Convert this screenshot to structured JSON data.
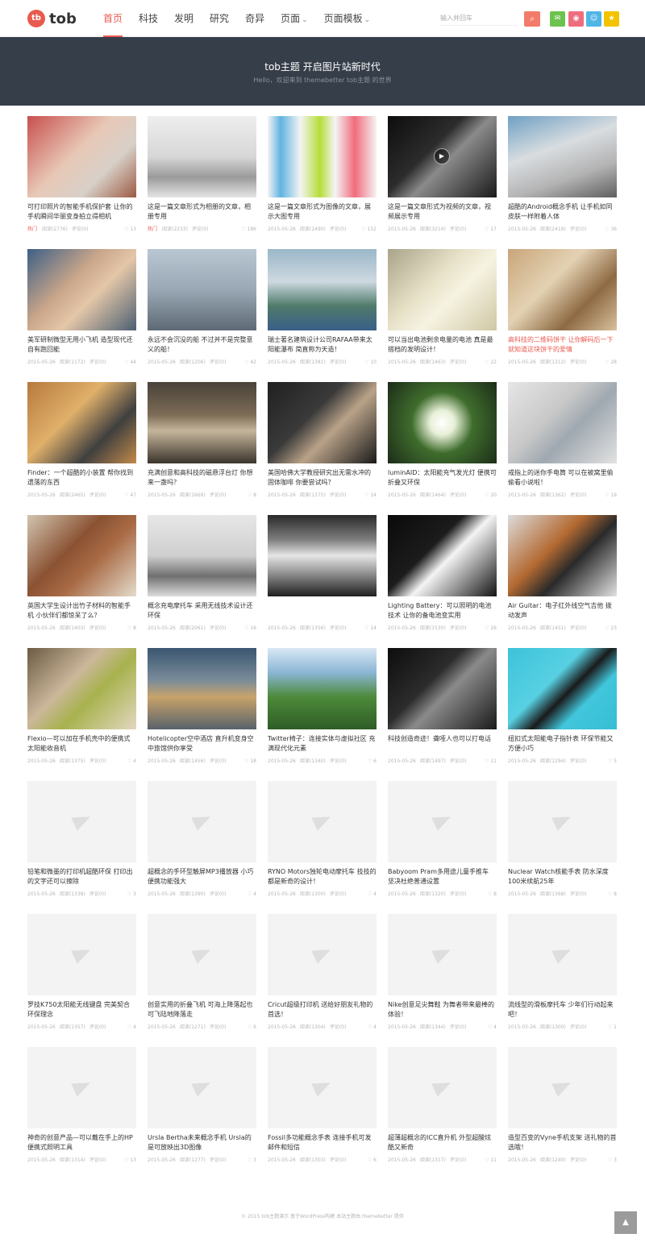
{
  "brand": {
    "name": "tob",
    "mark": "tb"
  },
  "nav": [
    {
      "label": "首页",
      "active": true
    },
    {
      "label": "科技"
    },
    {
      "label": "发明"
    },
    {
      "label": "研究"
    },
    {
      "label": "奇异"
    },
    {
      "label": "页面",
      "caret": "⌄"
    },
    {
      "label": "页面模板",
      "caret": "⌄"
    }
  ],
  "search": {
    "placeholder": "输入并回车",
    "icon": "search-icon"
  },
  "social": [
    "wechat-icon",
    "weibo-icon",
    "qq-icon",
    "star-icon"
  ],
  "banner": {
    "title": "tob主题 开启图片站新时代",
    "subtitle": "Hello，欢迎来到 themebetter tob主题 的世界"
  },
  "colors": {
    "accent": "#e95a4f",
    "banner_bg": "#363e4a"
  },
  "cards": [
    {
      "title": "可打印照片的智能手机保护套 让你的手机瞬间华丽变身拍立得相机",
      "tag": "热门",
      "date": "",
      "views": "阅读(2776)",
      "comments": "评论(0)",
      "likes": "13",
      "bg": "linear-gradient(135deg,#c8504e 0%,#e8c8b6 45%,#d8d0c8 70%,#9b5b43 100%)"
    },
    {
      "title": "这是一篇文章形式为相册的文章，相册专用",
      "tag": "热门",
      "date": "",
      "views": "阅读(2233)",
      "comments": "评论(0)",
      "likes": "186",
      "bg": "linear-gradient(180deg,#eeeeee 0%,#d7d7d7 50%,#9a9a9a 75%,#e5e5e5 100%)"
    },
    {
      "title": "这是一篇文章形式为图像的文章，展示大图专用",
      "tag": "",
      "date": "2015-05-26",
      "views": "阅读(1490)",
      "comments": "评论(0)",
      "likes": "152",
      "bg": "linear-gradient(90deg,#f4f4f4 0%,#5fb3e0 12%,#f4f4f4 30%,#b6dd3a 48%,#f4f4f4 62%,#f06c7c 80%,#f4f4f4 100%)"
    },
    {
      "title": "这是一篇文章形式为视频的文章，视频展示专用",
      "tag": "",
      "date": "2015-05-26",
      "views": "阅读(3214)",
      "comments": "评论(0)",
      "likes": "17",
      "bg": "linear-gradient(135deg,#0d0d0d 0%,#2c2c2c 40%,#8a8a8a 55%,#1a1a1a 100%)",
      "play": true
    },
    {
      "title": "超酷的Android概念手机 让手机如同皮肤一样附着人体",
      "tag": "",
      "date": "2015-05-26",
      "views": "阅读(2419)",
      "comments": "评论(0)",
      "likes": "36",
      "bg": "linear-gradient(160deg,#6fa0c4 0%,#d9dde0 40%,#b3b3b3 70%,#5f5f5f 100%)"
    },
    {
      "title": "美军研制微型无用小飞机 造型现代还自有跑回能",
      "tag": "",
      "date": "2015-05-26",
      "views": "阅读(1172)",
      "comments": "评论(0)",
      "likes": "44",
      "bg": "linear-gradient(135deg,#3d5f86 0%,#caa68a 40%,#e4c6a8 60%,#4c5f72 100%)"
    },
    {
      "title": "永远不会沉没的船 不过并不是完整意义的船！",
      "tag": "",
      "date": "2015-05-26",
      "views": "阅读(1206)",
      "comments": "评论(0)",
      "likes": "42",
      "bg": "linear-gradient(180deg,#b9c7d3 0%,#9aa8b5 50%,#5d6a75 100%)"
    },
    {
      "title": "瑞士著名建筑设计公司RAFAA带来太阳能瀑布 简直称为天造！",
      "tag": "",
      "date": "2015-05-26",
      "views": "阅读(1381)",
      "comments": "评论(0)",
      "likes": "10",
      "bg": "linear-gradient(180deg,#9bb7c8 0%,#cdd9e0 40%,#4f7a6a 70%,#3a5f88 100%)"
    },
    {
      "title": "可以当出电池剩余电量的电池 真是最搭档的发明设计！",
      "tag": "",
      "date": "2015-05-26",
      "views": "阅读(1463)",
      "comments": "评论(0)",
      "likes": "22",
      "bg": "linear-gradient(135deg,#a9a38a 0%,#e6e0c6 40%,#f6f3e2 60%,#cfc7a4 100%)"
    },
    {
      "title": "高科技的二维码饼干 让你解码后一下就知道这块饼干的爱情",
      "tag": "",
      "date": "2015-05-26",
      "views": "阅读(1312)",
      "comments": "评论(0)",
      "likes": "28",
      "bg": "linear-gradient(135deg,#c9a57a 0%,#e4d2b4 40%,#8d6a43 70%,#d8c19e 100%)",
      "red": true
    },
    {
      "title": "Finder：一个超酷的小装置 帮你找到遗落的东西",
      "tag": "",
      "date": "2015-05-26",
      "views": "阅读(2465)",
      "comments": "评论(0)",
      "likes": "47",
      "bg": "linear-gradient(135deg,#b7793d 0%,#e0b06a 40%,#3f3f3f 70%,#c38a4a 100%)"
    },
    {
      "title": "充满创意和高科技的磁悬浮台灯 你想来一盏吗？",
      "tag": "",
      "date": "2015-05-26",
      "views": "阅读(1669)",
      "comments": "评论(0)",
      "likes": "8",
      "bg": "linear-gradient(180deg,#48423a 0%,#7c6b55 40%,#c5b59b 60%,#3b342c 100%)"
    },
    {
      "title": "美国哈佛大学教授研究出无需水冲的固体咖啡 你要尝试吗？",
      "tag": "",
      "date": "2015-05-26",
      "views": "阅读(1375)",
      "comments": "评论(0)",
      "likes": "14",
      "bg": "linear-gradient(135deg,#202020 0%,#3a3a3a 40%,#b9a288 60%,#1a1a1a 100%)"
    },
    {
      "title": "luminAID：太阳能充气发光灯 便携可折叠又环保",
      "tag": "",
      "date": "2015-05-26",
      "views": "阅读(1464)",
      "comments": "评论(0)",
      "likes": "20",
      "bg": "radial-gradient(circle at 50% 50%,#ffffff 0%,#e8f0d8 18%,#3f6d2d 45%,#1c2c18 100%)"
    },
    {
      "title": "戒指上的迷你手电筒 可以在被窝里偷偷看小说啦！",
      "tag": "",
      "date": "2015-05-26",
      "views": "阅读(1362)",
      "comments": "评论(0)",
      "likes": "19",
      "bg": "linear-gradient(135deg,#e6e6e6 0%,#c8c8c8 40%,#9fa8b0 60%,#e2e2e2 100%)"
    },
    {
      "title": "英国大学生设计出竹子材料的智能手机 小伙伴们都惊呆了么？",
      "tag": "",
      "date": "2015-05-26",
      "views": "阅读(1403)",
      "comments": "评论(0)",
      "likes": "8",
      "bg": "linear-gradient(135deg,#d2c5b0 0%,#8a5233 40%,#a86a44 60%,#e5dccc 100%)"
    },
    {
      "title": "概念充电摩托车 采用无线技术设计还环保",
      "tag": "",
      "date": "2015-05-26",
      "views": "阅读(2061)",
      "comments": "评论(0)",
      "likes": "16",
      "bg": "linear-gradient(180deg,#e7e7e7 0%,#cfcfcf 50%,#6f6f6f 75%,#dcdcdc 100%)"
    },
    {
      "title": "",
      "tag": "",
      "date": "2015-05-26",
      "views": "阅读(1356)",
      "comments": "评论(0)",
      "likes": "14",
      "bg": "linear-gradient(180deg,#2a2a2a 0%,#7d7d7d 30%,#e6e6e6 50%,#1f1f1f 100%)"
    },
    {
      "title": "Lighting Battery：可以照明的电池技术 让你的备电池变实用",
      "tag": "",
      "date": "2015-05-26",
      "views": "阅读(1530)",
      "comments": "评论(0)",
      "likes": "26",
      "bg": "linear-gradient(135deg,#0a0a0a 0%,#1c1c1c 40%,#f4f4f4 55%,#131313 100%)"
    },
    {
      "title": "Air Guitar：电子红外线空气吉他 拨动发声",
      "tag": "",
      "date": "2015-05-26",
      "views": "阅读(1451)",
      "comments": "评论(0)",
      "likes": "23",
      "bg": "linear-gradient(135deg,#dcdcdc 0%,#b46a32 40%,#2a2a2a 60%,#e2e2e2 100%)"
    },
    {
      "title": "Flexio—可以加在手机壳中的便携式太阳能收音机",
      "tag": "",
      "date": "2015-05-26",
      "views": "阅读(1375)",
      "comments": "评论(0)",
      "likes": "4",
      "bg": "linear-gradient(135deg,#6c5a43 0%,#cbb89b 40%,#a7b24d 60%,#e3d7c0 100%)"
    },
    {
      "title": "Hotelicopter空中酒店 直升机变身空中旅馆供你享受",
      "tag": "",
      "date": "2015-05-26",
      "views": "阅读(1456)",
      "comments": "评论(0)",
      "likes": "18",
      "bg": "linear-gradient(180deg,#3a5670 0%,#7b8c9a 40%,#c8a36a 60%,#59626b 100%)"
    },
    {
      "title": "Twitter椅子：连接实体与虚拟社区 充满现代化元素",
      "tag": "",
      "date": "2015-05-26",
      "views": "阅读(1340)",
      "comments": "评论(0)",
      "likes": "6",
      "bg": "linear-gradient(180deg,#d9e8f3 0%,#8bb6d6 30%,#4d8a3a 60%,#2f5d26 100%)"
    },
    {
      "title": "科技创造奇迹！聋哑人也可以打电话",
      "tag": "",
      "date": "2015-05-26",
      "views": "阅读(1497)",
      "comments": "评论(0)",
      "likes": "11",
      "bg": "linear-gradient(135deg,#0d0d0d 0%,#2c2c2c 40%,#8a8a8a 55%,#1a1a1a 100%)"
    },
    {
      "title": "纽扣式太阳能电子指针表 环保节能又方便小巧",
      "tag": "",
      "date": "2015-05-26",
      "views": "阅读(1294)",
      "comments": "评论(0)",
      "likes": "5",
      "bg": "linear-gradient(135deg,#3cc3db 0%,#58d0e2 40%,#1a1a1a 55%,#41c6dc 70%,#36bdd5 100%)"
    },
    {
      "title": "铅笔和微墨的打印机超酷环保 打印出的文字还可以擦除",
      "tag": "",
      "date": "2015-05-26",
      "views": "阅读(1338)",
      "comments": "评论(0)",
      "likes": "3",
      "placeholder": true
    },
    {
      "title": "超概念的手环型触屏MP3播放器 小巧便携功能强大",
      "tag": "",
      "date": "2015-05-26",
      "views": "阅读(1390)",
      "comments": "评论(0)",
      "likes": "4",
      "placeholder": true
    },
    {
      "title": "RYNO Motors独轮电动摩托车 技技的都是新奇的设计！",
      "tag": "",
      "date": "2015-05-26",
      "views": "阅读(1300)",
      "comments": "评论(0)",
      "likes": "4",
      "placeholder": true
    },
    {
      "title": "Babyoom Pram多用途儿童手推车 坚决杜绝普通设置",
      "tag": "",
      "date": "2015-05-26",
      "views": "阅读(1320)",
      "comments": "评论(0)",
      "likes": "8",
      "placeholder": true
    },
    {
      "title": "Nuclear Watch核能手表 防水深度100米续航25年",
      "tag": "",
      "date": "2015-05-26",
      "views": "阅读(1368)",
      "comments": "评论(0)",
      "likes": "8",
      "placeholder": true
    },
    {
      "title": "罗技K750太阳能无线键盘 完美契合环保理念",
      "tag": "",
      "date": "2015-05-26",
      "views": "阅读(1357)",
      "comments": "评论(0)",
      "likes": "4",
      "placeholder": true
    },
    {
      "title": "创意实用的折叠飞机 可海上降落起也可飞陆地降落走",
      "tag": "",
      "date": "2015-05-26",
      "views": "阅读(1271)",
      "comments": "评论(0)",
      "likes": "6",
      "placeholder": true
    },
    {
      "title": "Cricut超级打印机 送给好朋友礼物的首选！",
      "tag": "",
      "date": "2015-05-26",
      "views": "阅读(1304)",
      "comments": "评论(0)",
      "likes": "4",
      "placeholder": true
    },
    {
      "title": "Nike创意足尖舞鞋 为舞者带来最棒的体验！",
      "tag": "",
      "date": "2015-05-26",
      "views": "阅读(1344)",
      "comments": "评论(0)",
      "likes": "4",
      "placeholder": true
    },
    {
      "title": "流线型的滑板摩托车 少年们行动起来吧！",
      "tag": "",
      "date": "2015-05-26",
      "views": "阅读(1300)",
      "comments": "评论(0)",
      "likes": "1",
      "placeholder": true
    },
    {
      "title": "神奇的创意产品—可以戴在手上的HP便携式照明工具",
      "tag": "",
      "date": "2015-05-26",
      "views": "阅读(1314)",
      "comments": "评论(0)",
      "likes": "13",
      "placeholder": true
    },
    {
      "title": "Ursla Bertha未来概念手机 Ursla的是可放映出3D图像",
      "tag": "",
      "date": "2015-05-26",
      "views": "阅读(1277)",
      "comments": "评论(0)",
      "likes": "3",
      "placeholder": true
    },
    {
      "title": "Fossil多功能概念手表 连接手机可发邮件和短信",
      "tag": "",
      "date": "2015-05-26",
      "views": "阅读(1303)",
      "comments": "评论(0)",
      "likes": "6",
      "placeholder": true
    },
    {
      "title": "超薄超概念的ICC直升机 外型超酸炫酷又新奇",
      "tag": "",
      "date": "2015-05-26",
      "views": "阅读(1317)",
      "comments": "评论(0)",
      "likes": "11",
      "placeholder": true
    },
    {
      "title": "造型百变的Vyne手机支架 送礼物的首选哦！",
      "tag": "",
      "date": "2015-05-26",
      "views": "阅读(1240)",
      "comments": "评论(0)",
      "likes": "3",
      "placeholder": true
    }
  ],
  "footer": {
    "text": "© 2015 tob主题演示  基于WordPress构建  本站主题由 themebetter 提供"
  },
  "back_to_top": {
    "icon": "arrow-up-icon",
    "glyph": "▲"
  }
}
